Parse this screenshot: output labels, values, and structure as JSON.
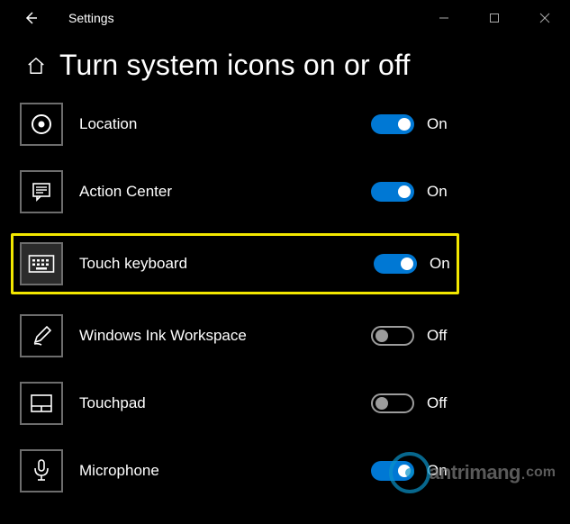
{
  "titlebar": {
    "title": "Settings"
  },
  "header": {
    "title": "Turn system icons on or off"
  },
  "labels": {
    "on": "On",
    "off": "Off"
  },
  "items": [
    {
      "key": "location",
      "label": "Location",
      "on": true,
      "icon": "location-icon"
    },
    {
      "key": "action-center",
      "label": "Action Center",
      "on": true,
      "icon": "action-center-icon"
    },
    {
      "key": "touch-keyboard",
      "label": "Touch keyboard",
      "on": true,
      "icon": "keyboard-icon",
      "highlight": true
    },
    {
      "key": "windows-ink",
      "label": "Windows Ink Workspace",
      "on": false,
      "icon": "pen-icon"
    },
    {
      "key": "touchpad",
      "label": "Touchpad",
      "on": false,
      "icon": "touchpad-icon"
    },
    {
      "key": "microphone",
      "label": "Microphone",
      "on": true,
      "icon": "microphone-icon"
    }
  ],
  "watermark": {
    "text": "antrimang",
    "suffix": "com"
  }
}
